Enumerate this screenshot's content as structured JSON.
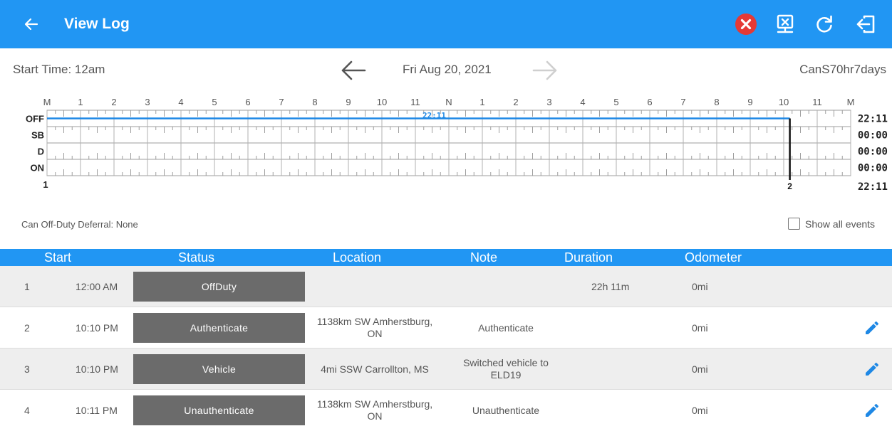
{
  "header": {
    "back_icon": "arrow-left-icon",
    "title": "View Log",
    "actions": [
      "close-circle-icon",
      "export-log-icon",
      "refresh-icon",
      "logout-icon"
    ],
    "close_color": "#e53935"
  },
  "subheader": {
    "start_time": "Start Time: 12am",
    "date": "Fri Aug 20, 2021",
    "cycle": "CanS70hr7days"
  },
  "graph": {
    "hour_labels": [
      "M",
      "1",
      "2",
      "3",
      "4",
      "5",
      "6",
      "7",
      "8",
      "9",
      "10",
      "11",
      "N",
      "1",
      "2",
      "3",
      "4",
      "5",
      "6",
      "7",
      "8",
      "9",
      "10",
      "11",
      "M"
    ],
    "rows": [
      "OFF",
      "SB",
      "D",
      "ON"
    ],
    "totals": [
      "22:11",
      "00:00",
      "00:00",
      "00:00"
    ],
    "grand_total": "22:11",
    "marker_label": "22:11",
    "start_label": "1",
    "end_label": "2",
    "line_color": "#1e88e5",
    "offduty_end_hour": 22.183
  },
  "deferral": "Can Off-Duty Deferral: None",
  "show_all_events": "Show all events",
  "table": {
    "headers": {
      "start": "Start",
      "status": "Status",
      "location": "Location",
      "note": "Note",
      "duration": "Duration",
      "odometer": "Odometer"
    },
    "rows": [
      {
        "num": "1",
        "start": "12:00 AM",
        "status": "OffDuty",
        "location": "",
        "note": "",
        "duration": "22h 11m",
        "odometer": "0mi",
        "editable": false
      },
      {
        "num": "2",
        "start": "10:10 PM",
        "status": "Authenticate",
        "location": "1138km SW Amherstburg, ON",
        "note": "Authenticate",
        "duration": "",
        "odometer": "0mi",
        "editable": true
      },
      {
        "num": "3",
        "start": "10:10 PM",
        "status": "Vehicle",
        "location": "4mi SSW Carrollton, MS",
        "note": "Switched vehicle  to ELD19",
        "duration": "",
        "odometer": "0mi",
        "editable": true
      },
      {
        "num": "4",
        "start": "10:11 PM",
        "status": "Unauthenticate",
        "location": "1138km SW Amherstburg, ON",
        "note": "Unauthenticate",
        "duration": "",
        "odometer": "0mi",
        "editable": true
      }
    ]
  }
}
